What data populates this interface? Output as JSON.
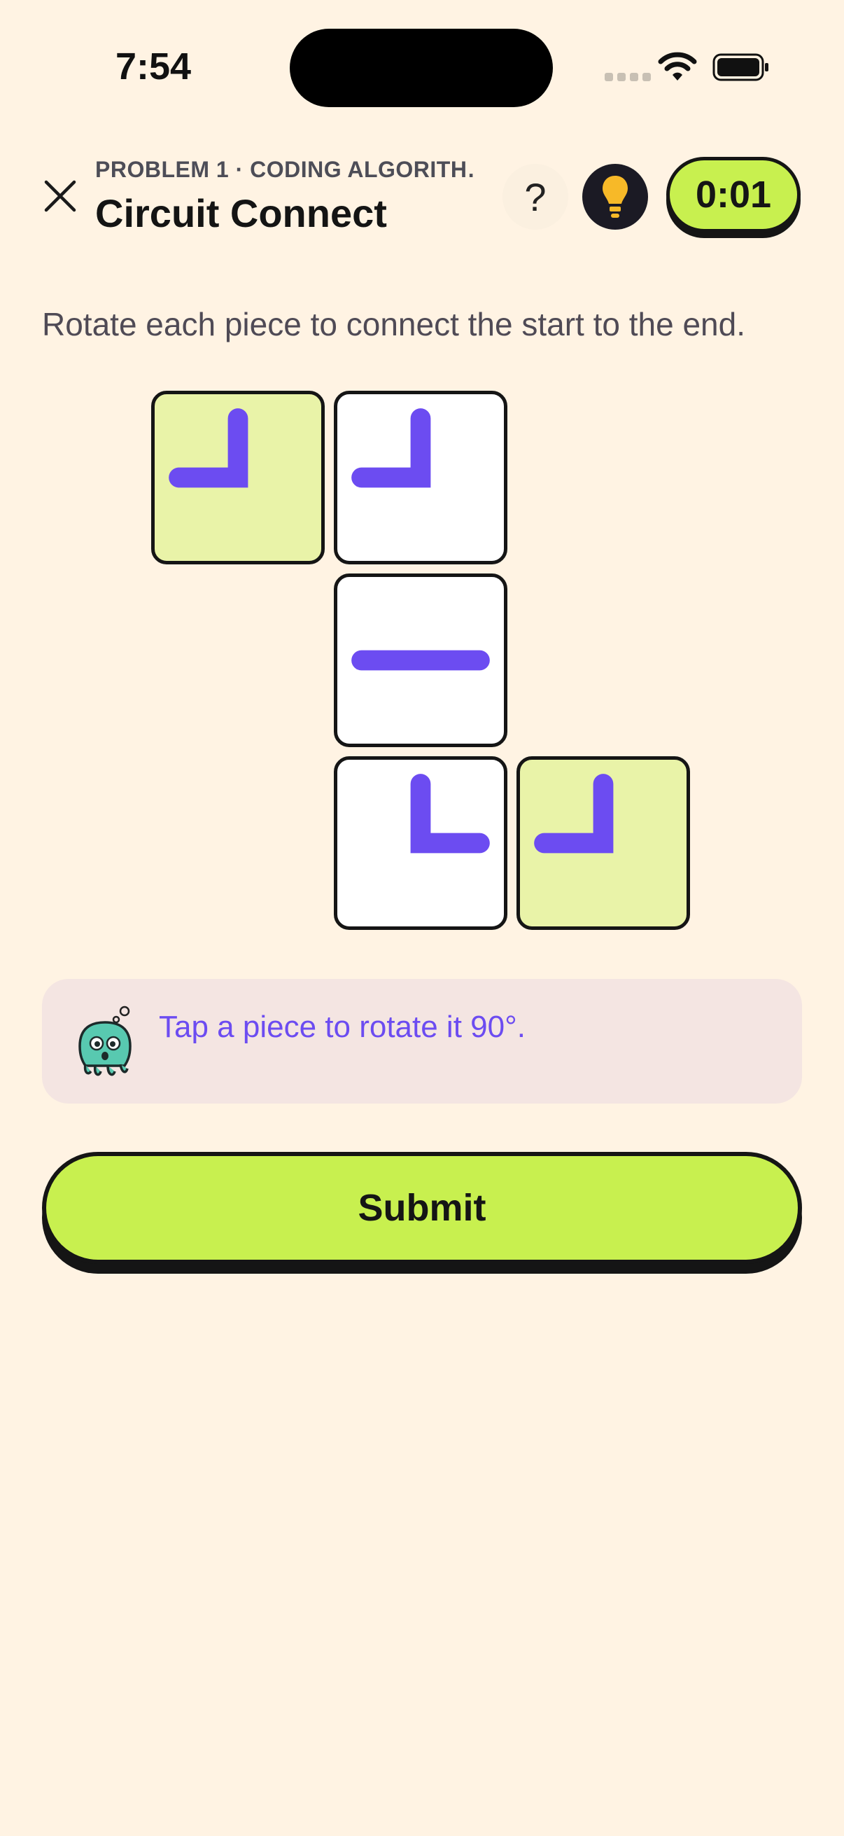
{
  "status_bar": {
    "time": "7:54"
  },
  "header": {
    "subtitle": "PROBLEM 1 · CODING ALGORITH…",
    "title": "Circuit Connect",
    "help_label": "?",
    "timer": "0:01"
  },
  "instruction": "Rotate each piece to connect the start to the end.",
  "puzzle": {
    "pieces": [
      {
        "type": "corner",
        "connects": [
          "up",
          "left"
        ],
        "role": "start"
      },
      {
        "type": "corner",
        "connects": [
          "up",
          "left"
        ],
        "role": "path"
      },
      {
        "type": "straight",
        "connects": [
          "left",
          "right"
        ],
        "role": "path"
      },
      {
        "type": "corner",
        "connects": [
          "up",
          "right"
        ],
        "role": "path"
      },
      {
        "type": "corner",
        "connects": [
          "up",
          "left"
        ],
        "role": "end"
      }
    ],
    "colors": {
      "pipe": "#6c4cf1",
      "endpoint_tile": "#e9f3a8",
      "tile": "#ffffff"
    }
  },
  "hint": {
    "text": "Tap a piece to rotate it 90°."
  },
  "submit_label": "Submit",
  "colors": {
    "accent": "#c8f04f",
    "background": "#fff3e3",
    "hint_text": "#6c4cf1"
  }
}
